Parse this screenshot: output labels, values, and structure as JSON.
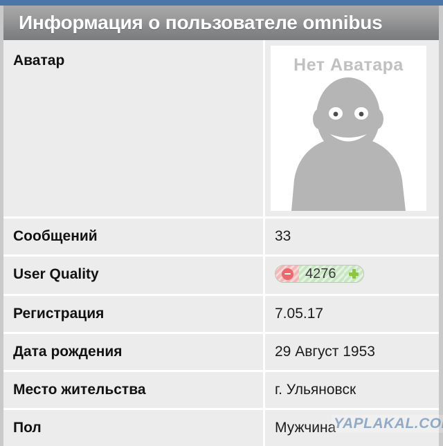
{
  "header": {
    "title": "Информация о пользователе omnibus",
    "accent_blue": "#4a76a8",
    "bar_gradient_top": "#a9a9a9",
    "bar_gradient_bottom": "#7b7c7e"
  },
  "avatar": {
    "placeholder_text": "Нет Аватара",
    "figure_color": "#b5b5b5",
    "background": "#ffffff"
  },
  "user_quality": {
    "score": "4276",
    "minus_icon": "minus-circle-icon",
    "plus_icon": "plus-icon",
    "negative_color": "#e8696e",
    "positive_color": "#8dc63f",
    "negative_bg": "#f2b8b8",
    "positive_bg": "#c9e6c2"
  },
  "rows": [
    {
      "label": "Аватар",
      "value": ""
    },
    {
      "label": "Сообщений",
      "value": "33"
    },
    {
      "label": "User Quality",
      "value": ""
    },
    {
      "label": "Регистрация",
      "value": "7.05.17"
    },
    {
      "label": "Дата рождения",
      "value": "29 Август 1953"
    },
    {
      "label": "Место жительства",
      "value": "г. Ульяновск"
    },
    {
      "label": "Пол",
      "value": "Мужчина"
    }
  ],
  "watermark": {
    "text": "YAPLAKAL.COM",
    "color": "#6f93b8"
  }
}
